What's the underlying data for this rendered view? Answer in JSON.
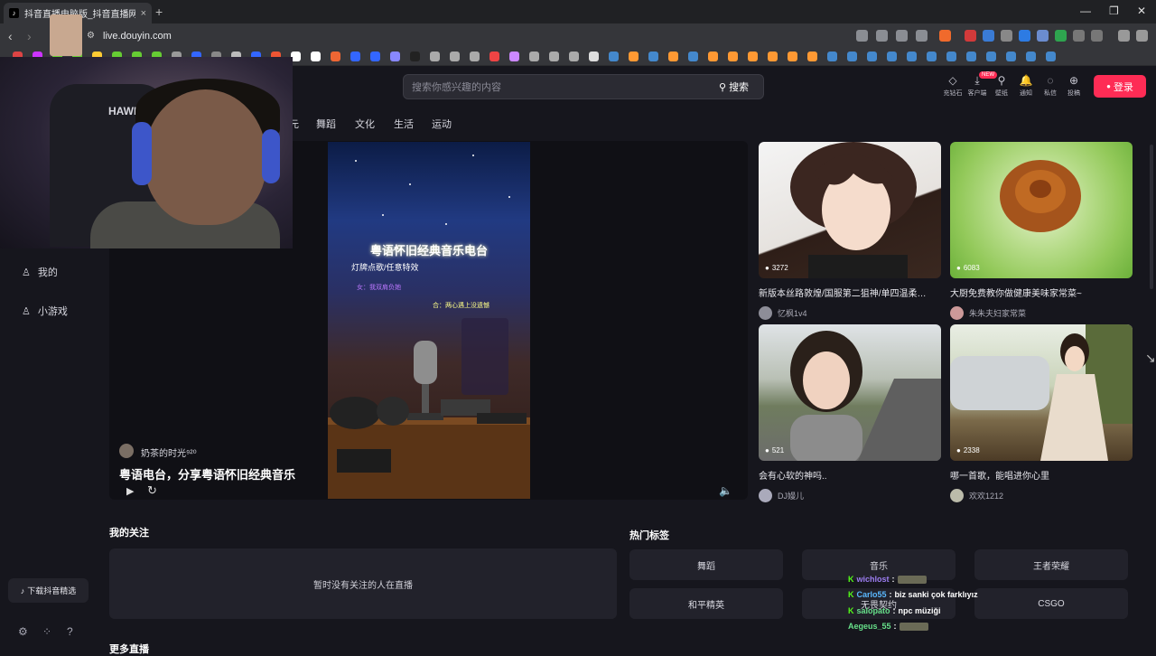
{
  "browser": {
    "tab_title": "抖音直播电脑版_抖音直播网页版",
    "tab_favicon": "♪",
    "tab_close": "×",
    "new_tab": "+",
    "minimize": "—",
    "restore": "❐",
    "close": "✕",
    "url": "live.douyin.com"
  },
  "header": {
    "search_placeholder": "搜索你感兴趣的内容",
    "search_button": "搜索",
    "icons": [
      {
        "name": "recharge",
        "label": "充钻石",
        "glyph": "◇"
      },
      {
        "name": "client",
        "label": "客户端",
        "glyph": "⤓"
      },
      {
        "name": "wallpaper",
        "label": "壁纸",
        "glyph": "⚲"
      },
      {
        "name": "notifications",
        "label": "通知",
        "glyph": "🔔"
      },
      {
        "name": "messages",
        "label": "私信",
        "glyph": "◌"
      },
      {
        "name": "submit",
        "label": "投稿",
        "glyph": "⊕"
      }
    ],
    "new_badge": "NEW",
    "login": "登录",
    "login_icon": "●"
  },
  "categories": [
    "元",
    "舞蹈",
    "文化",
    "生活",
    "运动"
  ],
  "sidebar": {
    "items": [
      {
        "label": "我的",
        "icon": "user-icon"
      },
      {
        "label": "小游戏",
        "icon": "game-icon"
      }
    ],
    "download_label": "下载抖音精选"
  },
  "player": {
    "streamer": "奶茶的时光⁹²⁰",
    "title": "粤语电台，分享粤语怀旧经典音乐",
    "video_title": "粤语怀旧经典音乐电台",
    "video_subtitle": "灯牌点歌/任意特效",
    "video_line1": "女：我双肩负她",
    "video_line2": "合：两心遇上没遗憾"
  },
  "recommended": [
    {
      "viewers": "3272",
      "title": "新版本丝路敦煌/国服第二狙神/单四温柔…",
      "author": "忆枫1v4",
      "bg": "anime"
    },
    {
      "viewers": "6083",
      "title": "大厨免费教你做健康美味家常菜~",
      "author": "朱朱夫妇家常菜",
      "bg": "food"
    },
    {
      "viewers": "521",
      "title": "会有心软的神吗..",
      "author": "DJ嫚儿",
      "bg": "street"
    },
    {
      "viewers": "2338",
      "title": "哪一首歌，能唱进你心里",
      "author": "欢欢1212",
      "bg": "car"
    }
  ],
  "my_follows": {
    "title": "我的关注",
    "empty_text": "暂时没有关注的人在直播"
  },
  "hot_tags": {
    "title": "热门标签",
    "tags": [
      "舞蹈",
      "音乐",
      "王者荣耀",
      "和平精英",
      "无畏契约",
      "CSGO"
    ]
  },
  "more_live_title": "更多直播",
  "chat": [
    {
      "user": "wichlost",
      "message": ""
    },
    {
      "user": "Carlo55",
      "message": "biz sanki çok farklıyız"
    },
    {
      "user": "salopato",
      "message": "npc müziği"
    },
    {
      "user": "Aegeus_55",
      "message": ""
    }
  ],
  "colors": {
    "accent": "#fe2c55",
    "page_bg": "#16161d",
    "card_bg": "#22222b",
    "kick_green": "#53fc18"
  }
}
